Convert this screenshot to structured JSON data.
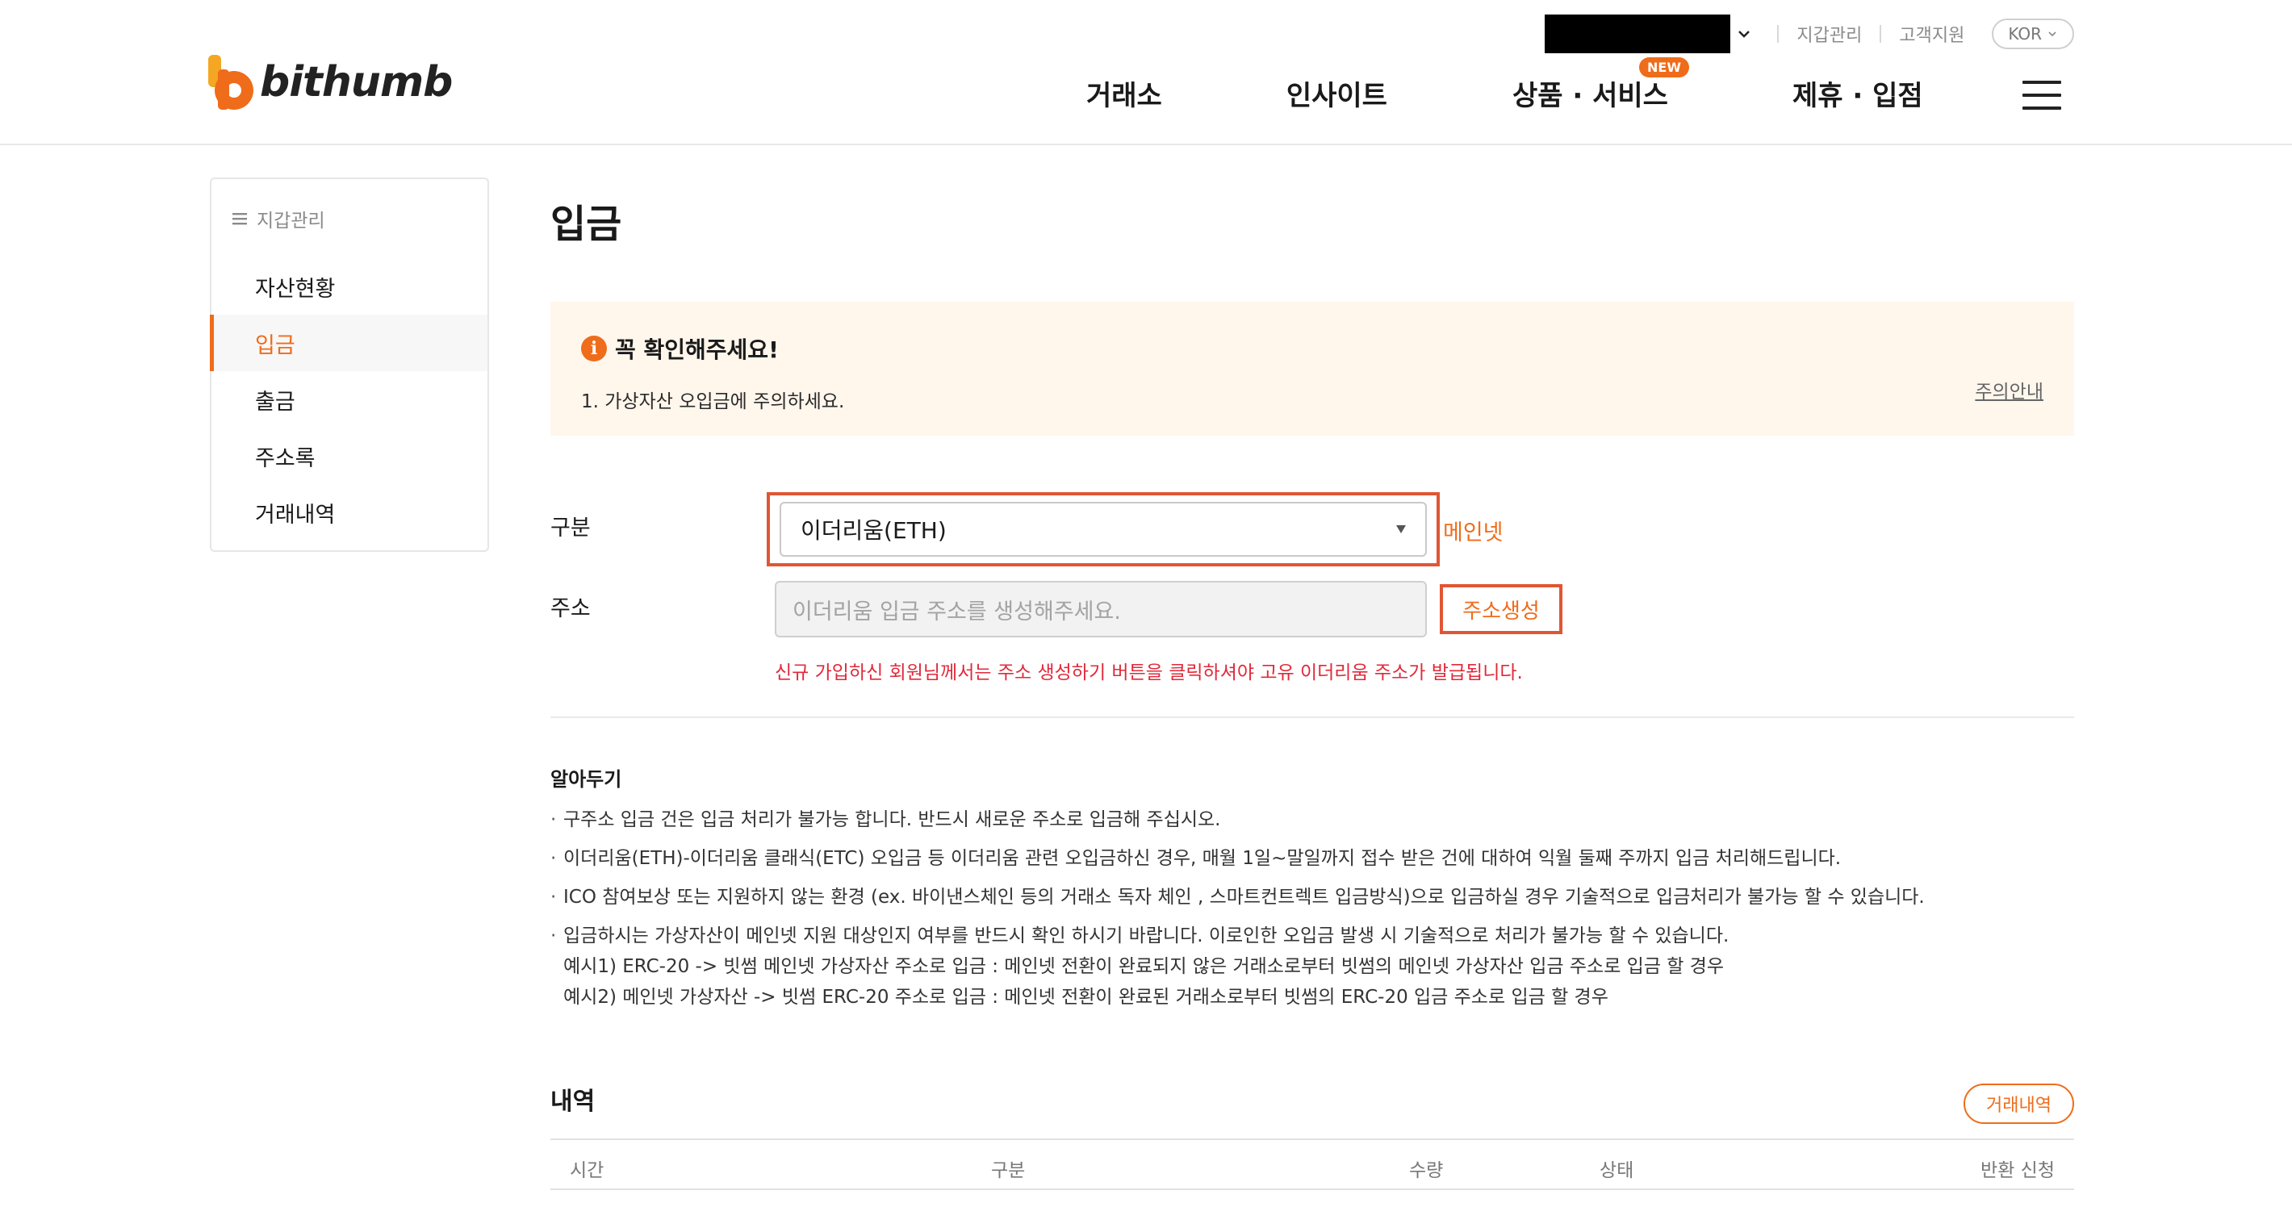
{
  "header": {
    "logo_text": "bithumb",
    "util_links": [
      "지갑관리",
      "고객지원"
    ],
    "language": "KOR",
    "nav": [
      "거래소",
      "인사이트",
      "상품 · 서비스",
      "제휴 · 입점"
    ],
    "new_badge": "NEW"
  },
  "sidebar": {
    "title": "지갑관리",
    "items": [
      {
        "label": "자산현황",
        "active": false
      },
      {
        "label": "입금",
        "active": true
      },
      {
        "label": "출금",
        "active": false
      },
      {
        "label": "주소록",
        "active": false
      },
      {
        "label": "거래내역",
        "active": false
      }
    ]
  },
  "main": {
    "title": "입금",
    "notice": {
      "title": "꼭 확인해주세요!",
      "text": "1. 가상자산 오입금에 주의하세요.",
      "link": "주의안내"
    },
    "form": {
      "type_label": "구분",
      "selected_coin": "이더리움(ETH)",
      "network": "메인넷",
      "address_label": "주소",
      "address_placeholder": "이더리움 입금 주소를 생성해주세요.",
      "generate_button": "주소생성",
      "hint": "신규 가입하신 회원님께서는 주소 생성하기 버튼을 클릭하셔야 고유 이더리움 주소가 발급됩니다."
    },
    "guide": {
      "title": "알아두기",
      "items": [
        "구주소 입금 건은 입금 처리가 불가능 합니다. 반드시 새로운 주소로 입금해 주십시오.",
        "이더리움(ETH)-이더리움 클래식(ETC) 오입금 등 이더리움 관련 오입금하신 경우, 매월 1일~말일까지 접수 받은 건에 대하여 익월 둘째 주까지 입금 처리해드립니다.",
        "ICO 참여보상 또는 지원하지 않는 환경 (ex. 바이낸스체인 등의 거래소 독자 체인 , 스마트컨트렉트 입금방식)으로 입금하실 경우 기술적으로 입금처리가 불가능 할 수 있습니다.",
        "입금하시는 가상자산이 메인넷 지원 대상인지 여부를 반드시 확인 하시기 바랍니다. 이로인한 오입금 발생 시 기술적으로 처리가 불가능 할 수 있습니다."
      ],
      "examples": [
        "예시1) ERC-20 -> 빗썸 메인넷 가상자산 주소로 입금 : 메인넷 전환이 완료되지 않은 거래소로부터 빗썸의 메인넷 가상자산 입금 주소로 입금 할 경우",
        "예시2) 메인넷 가상자산 -> 빗썸 ERC-20 주소로 입금 : 메인넷 전환이 완료된 거래소로부터 빗썸의 ERC-20 입금 주소로 입금 할 경우"
      ]
    },
    "history": {
      "title": "내역",
      "button": "거래내역",
      "columns": [
        "시간",
        "구분",
        "수량",
        "상태",
        "반환 신청"
      ]
    }
  },
  "colors": {
    "accent": "#ef6c1a",
    "highlight_border": "#e05634",
    "notice_bg": "#fff6ec",
    "error_text": "#e0293a"
  }
}
